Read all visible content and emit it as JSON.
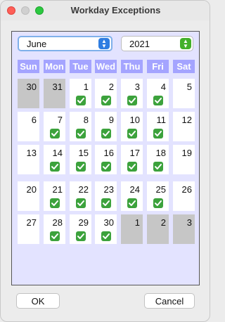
{
  "window": {
    "title": "Workday Exceptions"
  },
  "month_select": {
    "value": "June"
  },
  "year_select": {
    "value": "2021"
  },
  "weekdays": [
    "Sun",
    "Mon",
    "Tue",
    "Wed",
    "Thu",
    "Fri",
    "Sat"
  ],
  "days": [
    {
      "day": "30",
      "current_month": false,
      "checked": false
    },
    {
      "day": "31",
      "current_month": false,
      "checked": false
    },
    {
      "day": "1",
      "current_month": true,
      "checked": true
    },
    {
      "day": "2",
      "current_month": true,
      "checked": true
    },
    {
      "day": "3",
      "current_month": true,
      "checked": true
    },
    {
      "day": "4",
      "current_month": true,
      "checked": true
    },
    {
      "day": "5",
      "current_month": true,
      "checked": false
    },
    {
      "day": "6",
      "current_month": true,
      "checked": false
    },
    {
      "day": "7",
      "current_month": true,
      "checked": true
    },
    {
      "day": "8",
      "current_month": true,
      "checked": true
    },
    {
      "day": "9",
      "current_month": true,
      "checked": true
    },
    {
      "day": "10",
      "current_month": true,
      "checked": true
    },
    {
      "day": "11",
      "current_month": true,
      "checked": true
    },
    {
      "day": "12",
      "current_month": true,
      "checked": false
    },
    {
      "day": "13",
      "current_month": true,
      "checked": false
    },
    {
      "day": "14",
      "current_month": true,
      "checked": true
    },
    {
      "day": "15",
      "current_month": true,
      "checked": true
    },
    {
      "day": "16",
      "current_month": true,
      "checked": true
    },
    {
      "day": "17",
      "current_month": true,
      "checked": true
    },
    {
      "day": "18",
      "current_month": true,
      "checked": true
    },
    {
      "day": "19",
      "current_month": true,
      "checked": false
    },
    {
      "day": "20",
      "current_month": true,
      "checked": false
    },
    {
      "day": "21",
      "current_month": true,
      "checked": true
    },
    {
      "day": "22",
      "current_month": true,
      "checked": true
    },
    {
      "day": "23",
      "current_month": true,
      "checked": true
    },
    {
      "day": "24",
      "current_month": true,
      "checked": true
    },
    {
      "day": "25",
      "current_month": true,
      "checked": true
    },
    {
      "day": "26",
      "current_month": true,
      "checked": false
    },
    {
      "day": "27",
      "current_month": true,
      "checked": false
    },
    {
      "day": "28",
      "current_month": true,
      "checked": true
    },
    {
      "day": "29",
      "current_month": true,
      "checked": true
    },
    {
      "day": "30",
      "current_month": true,
      "checked": true
    },
    {
      "day": "1",
      "current_month": false,
      "checked": false
    },
    {
      "day": "2",
      "current_month": false,
      "checked": false
    },
    {
      "day": "3",
      "current_month": false,
      "checked": false
    }
  ],
  "buttons": {
    "ok": "OK",
    "cancel": "Cancel"
  },
  "colors": {
    "header_bg": "#a4a4ff",
    "panel_bg": "#e3e3ff",
    "other_month_bg": "#c6c6c6",
    "check_green": "#3ca23c"
  },
  "icons": {
    "check": "check-icon",
    "month_spinner": "chevron-updown-icon",
    "year_spinner": "chevron-updown-icon"
  }
}
